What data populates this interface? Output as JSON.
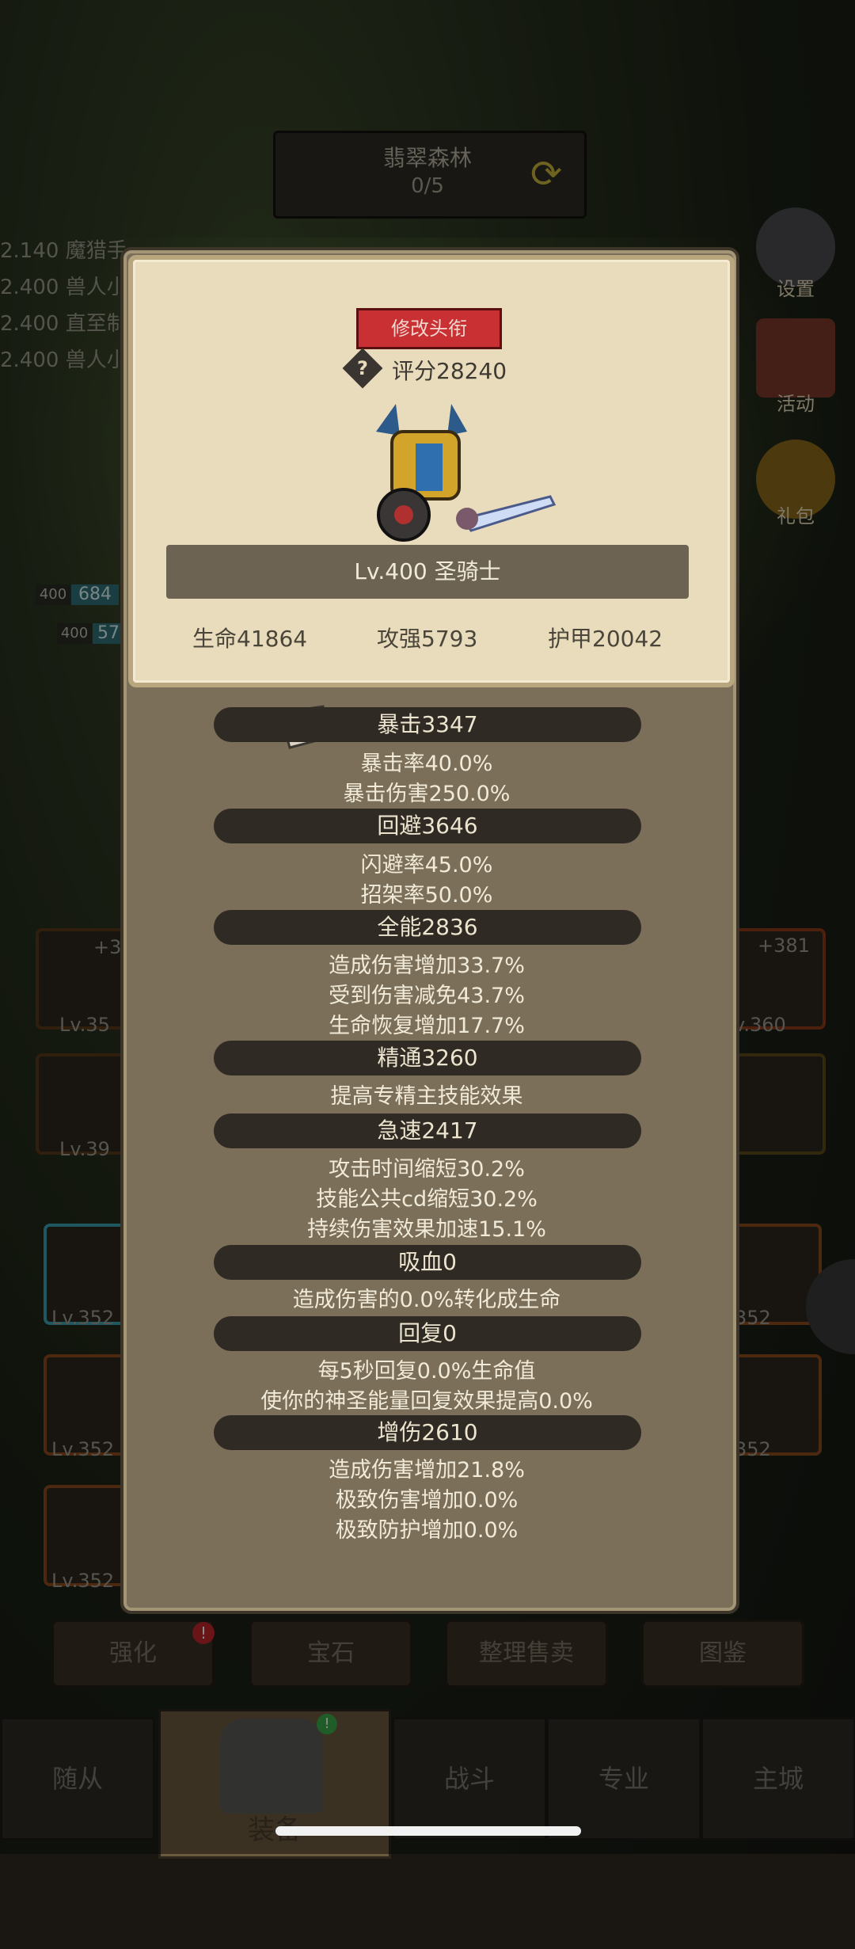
{
  "zone": {
    "name": "翡翠森林",
    "progress": "0/5"
  },
  "battle_log": [
    {
      "level": "2.140",
      "text": "魔猎手"
    },
    {
      "level": "2.400",
      "text": "兽人小"
    },
    {
      "level": "2.400",
      "text": "直至制"
    },
    {
      "level": "2.400",
      "text": "兽人小"
    }
  ],
  "party_levels": {
    "a": "400",
    "a_val": "684",
    "b": "400",
    "b_val": "57"
  },
  "side_menu": {
    "settings_label": "设置",
    "events_label": "活动",
    "gift_label": "礼包"
  },
  "equipment": {
    "left": [
      {
        "plus": "+3",
        "level": "Lv.35"
      },
      {
        "plus": "",
        "level": "Lv.39"
      }
    ],
    "right": [
      {
        "plus": "+381",
        "level": "v.360"
      }
    ],
    "inventory_left": [
      "Lv.352",
      "Lv.352",
      "Lv.352"
    ],
    "inventory_right": [
      "352",
      "352"
    ]
  },
  "bottom_buttons": {
    "enhance": "强化",
    "gem": "宝石",
    "sell": "整理售卖",
    "codex": "图鉴"
  },
  "nav": {
    "followers": "随从",
    "equipment": "装备",
    "battle": "战斗",
    "profession": "专业",
    "city": "主城"
  },
  "modal": {
    "change_title_button": "修改头衔",
    "score": "评分28240",
    "hero": "Lv.400 圣骑士",
    "base_stats": {
      "hp": "生命41864",
      "atk": "攻强5793",
      "armor": "护甲20042"
    },
    "sections": [
      {
        "header": "暴击3347",
        "lines": [
          "暴击率40.0%",
          "暴击伤害250.0%"
        ]
      },
      {
        "header": "回避3646",
        "lines": [
          "闪避率45.0%",
          "招架率50.0%"
        ]
      },
      {
        "header": "全能2836",
        "lines": [
          "造成伤害增加33.7%",
          "受到伤害减免43.7%",
          "生命恢复增加17.7%"
        ]
      },
      {
        "header": "精通3260",
        "lines": [
          "提高专精主技能效果"
        ]
      },
      {
        "header": "急速2417",
        "lines": [
          "攻击时间缩短30.2%",
          "技能公共cd缩短30.2%",
          "持续伤害效果加速15.1%"
        ]
      },
      {
        "header": "吸血0",
        "lines": [
          "造成伤害的0.0%转化成生命"
        ]
      },
      {
        "header": "回复0",
        "lines": [
          "每5秒回复0.0%生命值",
          "使你的神圣能量回复效果提高0.0%"
        ]
      },
      {
        "header": "增伤2610",
        "lines": [
          "造成伤害增加21.8%",
          "极致伤害增加0.0%",
          "极致防护增加0.0%"
        ]
      }
    ]
  },
  "colors": {
    "accent_red": "#c83033",
    "parchment": "#e9dcbd",
    "panel": "#7b6f59"
  }
}
